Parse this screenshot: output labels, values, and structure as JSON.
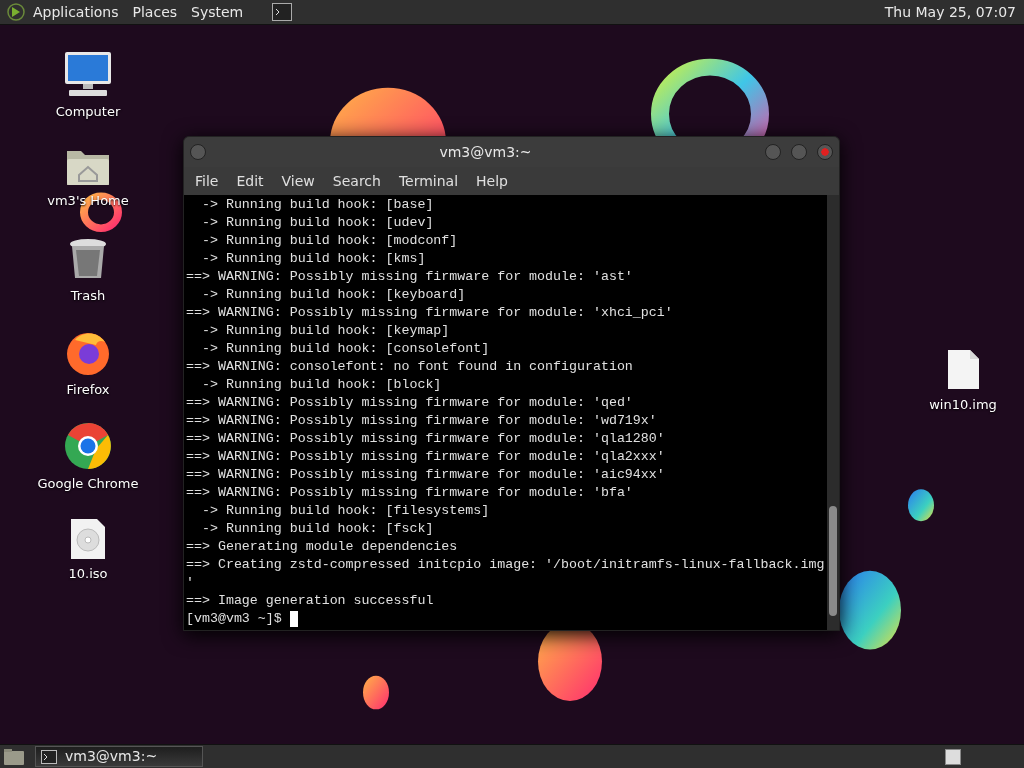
{
  "top_panel": {
    "menus": [
      "Applications",
      "Places",
      "System"
    ],
    "clock": "Thu May 25, 07:07"
  },
  "desktop_icons": [
    {
      "label": "Computer",
      "kind": "computer"
    },
    {
      "label": "vm3's Home",
      "kind": "home"
    },
    {
      "label": "Trash",
      "kind": "trash"
    },
    {
      "label": "Firefox",
      "kind": "firefox"
    },
    {
      "label": "Google Chrome",
      "kind": "chrome"
    },
    {
      "label": "10.iso",
      "kind": "disc"
    }
  ],
  "right_icons": [
    {
      "label": "win10.img",
      "kind": "file"
    }
  ],
  "terminal": {
    "title": "vm3@vm3:~",
    "menu": [
      "File",
      "Edit",
      "View",
      "Search",
      "Terminal",
      "Help"
    ],
    "lines": [
      "  -> Running build hook: [base]",
      "  -> Running build hook: [udev]",
      "  -> Running build hook: [modconf]",
      "  -> Running build hook: [kms]",
      "==> WARNING: Possibly missing firmware for module: 'ast'",
      "  -> Running build hook: [keyboard]",
      "==> WARNING: Possibly missing firmware for module: 'xhci_pci'",
      "  -> Running build hook: [keymap]",
      "  -> Running build hook: [consolefont]",
      "==> WARNING: consolefont: no font found in configuration",
      "  -> Running build hook: [block]",
      "==> WARNING: Possibly missing firmware for module: 'qed'",
      "==> WARNING: Possibly missing firmware for module: 'wd719x'",
      "==> WARNING: Possibly missing firmware for module: 'qla1280'",
      "==> WARNING: Possibly missing firmware for module: 'qla2xxx'",
      "==> WARNING: Possibly missing firmware for module: 'aic94xx'",
      "==> WARNING: Possibly missing firmware for module: 'bfa'",
      "  -> Running build hook: [filesystems]",
      "  -> Running build hook: [fsck]",
      "==> Generating module dependencies",
      "==> Creating zstd-compressed initcpio image: '/boot/initramfs-linux-fallback.img",
      "'",
      "==> Image generation successful"
    ],
    "prompt": "[vm3@vm3 ~]$"
  },
  "taskbar": {
    "windows": [
      {
        "label": "vm3@vm3:~",
        "selected": true
      }
    ]
  }
}
